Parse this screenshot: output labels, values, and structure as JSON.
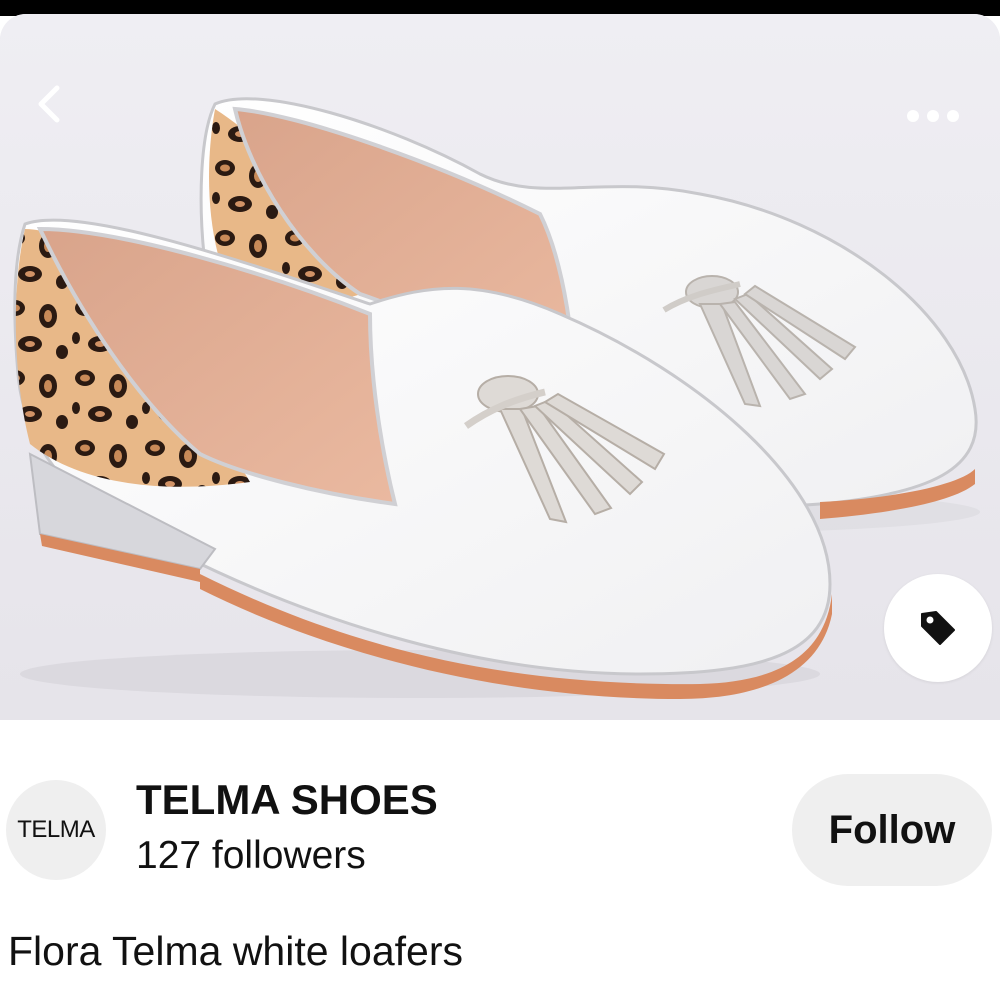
{
  "image": {
    "alt": "Flora Telma white loafers"
  },
  "nav": {
    "back_icon": "chevron-left-icon",
    "more_icon": "more-horizontal-icon"
  },
  "product_tag": {
    "icon": "price-tag-icon"
  },
  "creator": {
    "avatar_text": "TELMA",
    "name": "TELMA SHOES",
    "followers": "127 followers",
    "follow_label": "Follow"
  },
  "pin": {
    "title": "Flora Telma white loafers"
  },
  "colors": {
    "follow_bg": "#efefef",
    "text": "#111111",
    "background": "#ffffff"
  }
}
